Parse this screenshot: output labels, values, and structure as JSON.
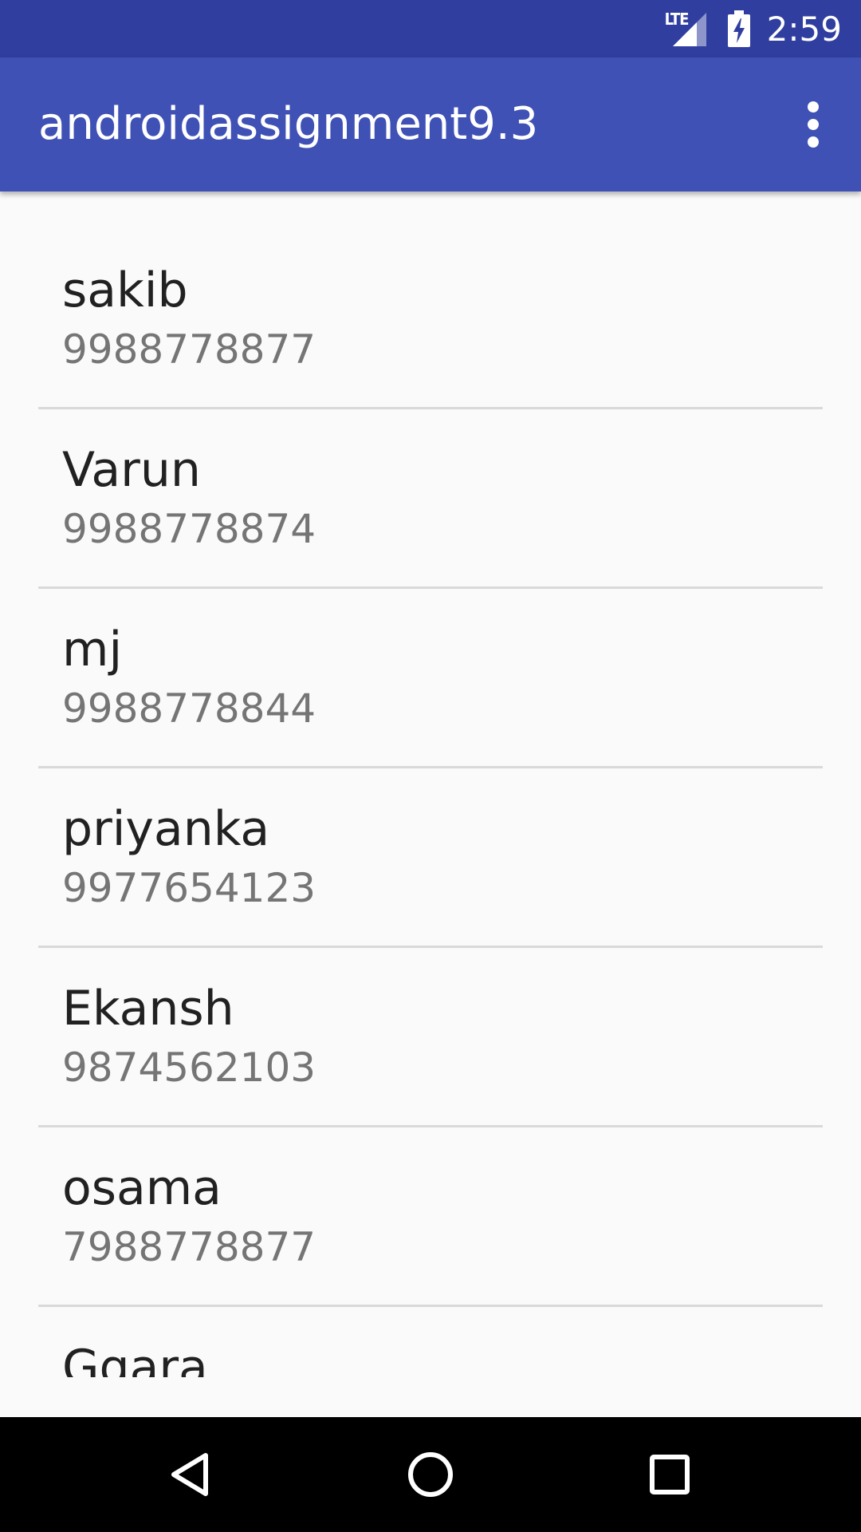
{
  "status_bar": {
    "network_label": "LTE",
    "time": "2:59",
    "icons": [
      "lte-signal-icon",
      "battery-charging-icon"
    ]
  },
  "app_bar": {
    "title": "androidassignment9.3",
    "menu_icon": "overflow-menu-icon",
    "color": "#3f51b5"
  },
  "contacts": [
    {
      "name": "sakib",
      "phone": "9988778877"
    },
    {
      "name": "Varun",
      "phone": "9988778874"
    },
    {
      "name": "mj",
      "phone": "9988778844"
    },
    {
      "name": "priyanka",
      "phone": "9977654123"
    },
    {
      "name": "Ekansh",
      "phone": "9874562103"
    },
    {
      "name": "osama",
      "phone": "7988778877"
    },
    {
      "name": "Ggara",
      "phone": ""
    }
  ],
  "nav_bar": {
    "buttons": [
      "back-icon",
      "home-icon",
      "recents-icon"
    ]
  },
  "colors": {
    "status_bar": "#303f9f",
    "app_bar": "#3f51b5",
    "background": "#fafafa",
    "divider": "#d9d9d9",
    "primary_text": "#212121",
    "secondary_text": "#757575"
  }
}
